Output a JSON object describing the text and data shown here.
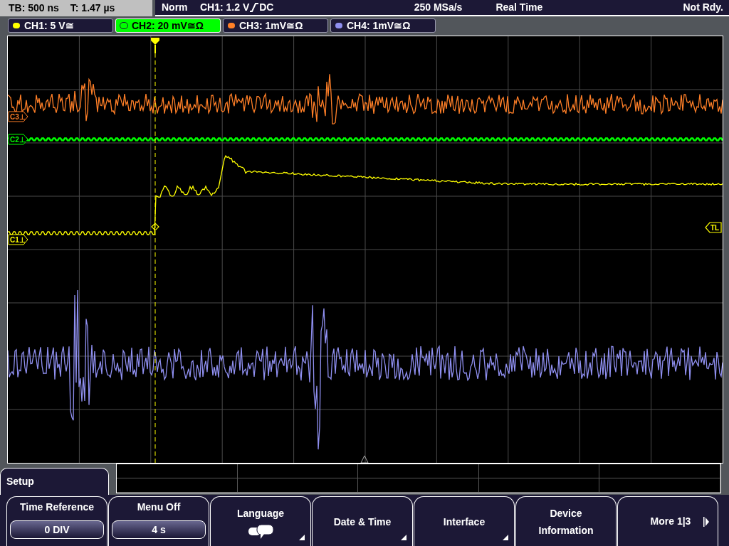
{
  "status_bar": {
    "timebase": "TB: 500 ns",
    "trigger_time": "T: 1.47 µs",
    "trigger_mode": "Norm",
    "trigger_source": "CH1: 1.2 V",
    "trigger_coupling": "DC",
    "sample_rate": "250 MSa/s",
    "acquisition": "Real Time",
    "state": "Not Rdy."
  },
  "channels": [
    {
      "label": "CH1: 5 V≅",
      "color": "#ffff00",
      "selected": false
    },
    {
      "label": "CH2: 20 mV≅Ω",
      "color": "#00ff00",
      "selected": true
    },
    {
      "label": "CH3: 1mV≅Ω",
      "color": "#ff7f27",
      "selected": false
    },
    {
      "label": "CH4: 1mV≅Ω",
      "color": "#8f8ff0",
      "selected": false
    }
  ],
  "channel_markers": [
    {
      "text": "C3⊥",
      "color": "#ff7f27"
    },
    {
      "text": "C2⊥",
      "color": "#00ff00"
    },
    {
      "text": "C1⊥",
      "color": "#ffff00"
    }
  ],
  "trigger_level_marker": "TL",
  "menu": {
    "title": "Setup",
    "softkeys": [
      {
        "kind": "value",
        "label": "Time Reference",
        "value": "0 DIV",
        "submenu": false
      },
      {
        "kind": "value",
        "label": "Menu Off",
        "value": "4 s",
        "submenu": false
      },
      {
        "kind": "icon",
        "label": "Language",
        "submenu": true
      },
      {
        "kind": "plain",
        "label": "Date & Time",
        "submenu": true
      },
      {
        "kind": "plain",
        "label": "Interface",
        "submenu": true
      },
      {
        "kind": "plain",
        "label": "Device Information",
        "submenu": false
      },
      {
        "kind": "next",
        "label": "More 1|3",
        "submenu": false
      }
    ]
  }
}
